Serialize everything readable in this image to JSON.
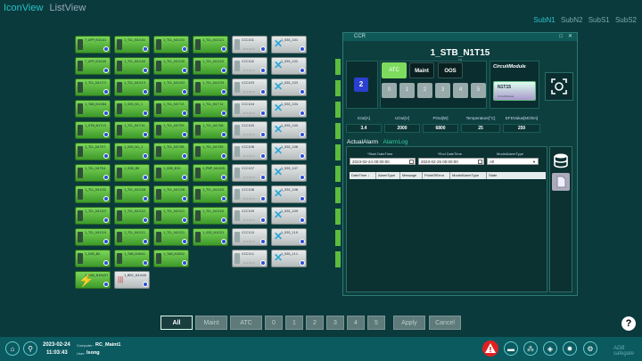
{
  "nav": {
    "iconview": "IconView",
    "listview": "ListView"
  },
  "subnav": [
    "SubN1",
    "SubN2",
    "SubS1",
    "SubS2"
  ],
  "tiles": [
    {
      "label": "7_APP_N1G41",
      "type": "green"
    },
    {
      "label": "1_TCL_N1G41",
      "type": "green"
    },
    {
      "label": "1_TCL_N1G31",
      "type": "green"
    },
    {
      "label": "1_TCL_N1G21",
      "type": "green"
    },
    {
      "label": "CCC101",
      "type": "grey"
    },
    {
      "label": "1_SSS_101",
      "type": "grey-x"
    },
    {
      "label": "7_APP_N1G40",
      "type": "green"
    },
    {
      "label": "1_TCL_N1G40",
      "type": "green"
    },
    {
      "label": "1_TCL_N1G30",
      "type": "green"
    },
    {
      "label": "1_TCL_N1G20",
      "type": "green"
    },
    {
      "label": "CCC102",
      "type": "grey"
    },
    {
      "label": "1_SSS_102",
      "type": "grey-x"
    },
    {
      "label": "1_TCL_N1G73",
      "type": "green"
    },
    {
      "label": "1_TCL_N1G13",
      "type": "green"
    },
    {
      "label": "1_TCL_N1G53",
      "type": "green"
    },
    {
      "label": "1_TCL_N1G33",
      "type": "green"
    },
    {
      "label": "CCC103",
      "type": "grey"
    },
    {
      "label": "1_SSS_103",
      "type": "grey-x"
    },
    {
      "label": "1_TAB_N1G64",
      "type": "green"
    },
    {
      "label": "1_SSS_N1_1",
      "type": "green"
    },
    {
      "label": "1_TCL_N1T13",
      "type": "green"
    },
    {
      "label": "1_TCL_N1T12",
      "type": "green"
    },
    {
      "label": "CCC104",
      "type": "grey"
    },
    {
      "label": "1_SSS_104",
      "type": "grey-x"
    },
    {
      "label": "1_STB_N1T15",
      "type": "green"
    },
    {
      "label": "1_TCL_N1T10",
      "type": "green"
    },
    {
      "label": "1_TCL_N1T09",
      "type": "green"
    },
    {
      "label": "1_TCL_N1T08",
      "type": "green"
    },
    {
      "label": "CCC105",
      "type": "grey"
    },
    {
      "label": "1_SSS_105",
      "type": "grey-x"
    },
    {
      "label": "1_TCL_N1T07",
      "type": "green"
    },
    {
      "label": "1_SSS_N1_1",
      "type": "green"
    },
    {
      "label": "1_TCL_N1T06",
      "type": "green"
    },
    {
      "label": "1_TCL_N1T05",
      "type": "green"
    },
    {
      "label": "CCC106",
      "type": "grey"
    },
    {
      "label": "1_SSS_106",
      "type": "grey-x"
    },
    {
      "label": "1_TCL_N1T04",
      "type": "green"
    },
    {
      "label": "1_SSB_B9",
      "type": "green"
    },
    {
      "label": "1_SSB_B10",
      "type": "green"
    },
    {
      "label": "1_PMP_N1G05",
      "type": "green"
    },
    {
      "label": "CCC107",
      "type": "grey"
    },
    {
      "label": "1_SSS_107",
      "type": "grey-x"
    },
    {
      "label": "1_TCL_N1G32",
      "type": "green"
    },
    {
      "label": "1_TCL_N1G26",
      "type": "green"
    },
    {
      "label": "1_TCL_N1G26",
      "type": "green"
    },
    {
      "label": "1_TCL_N1G25",
      "type": "green"
    },
    {
      "label": "CCC108",
      "type": "grey"
    },
    {
      "label": "1_SSS_108",
      "type": "grey-x"
    },
    {
      "label": "1_TCL_N1G23",
      "type": "green"
    },
    {
      "label": "1_TCL_N1G22",
      "type": "green"
    },
    {
      "label": "1_TCL_N1G21",
      "type": "green"
    },
    {
      "label": "1_TCL_N1G20",
      "type": "green"
    },
    {
      "label": "CCC109",
      "type": "grey"
    },
    {
      "label": "1_SSS_109",
      "type": "grey-x"
    },
    {
      "label": "1_TCL_N1G19",
      "type": "green"
    },
    {
      "label": "1_TCL_N1G21",
      "type": "green"
    },
    {
      "label": "1_TCL_N1G21",
      "type": "green"
    },
    {
      "label": "1_SSS_N1G21",
      "type": "green"
    },
    {
      "label": "CCC110",
      "type": "grey"
    },
    {
      "label": "1_SSS_110",
      "type": "grey-x"
    },
    {
      "label": "1_SSB_B2",
      "type": "green"
    },
    {
      "label": "1_TAB_N1B01",
      "type": "green"
    },
    {
      "label": "1_TAB_N1B02",
      "type": "green"
    },
    {
      "label": "",
      "type": "empty"
    },
    {
      "label": "CCC111",
      "type": "grey"
    },
    {
      "label": "1_SSS_111",
      "type": "grey-x"
    },
    {
      "label": "1_SSB_N1B43T",
      "type": "bolt"
    },
    {
      "label": "1_BRC_N1G46",
      "type": "grey-b"
    }
  ],
  "ccr": {
    "window_title": "CCR",
    "device_name": "1_STB_N1T15",
    "device_sub": "TN",
    "blue_index": "2",
    "modes": [
      "ATC",
      "Maint",
      "OOS"
    ],
    "nums": [
      "0",
      "1",
      "2",
      "3",
      "4",
      "5"
    ],
    "circuit_module_label": "CircuitModule",
    "circuit_module_name": "N1T15",
    "circuit_module_sub": "CircuitModule",
    "metrics": [
      {
        "name": "IOut[A]",
        "value": "3.4"
      },
      {
        "name": "UOut[V]",
        "value": "2000"
      },
      {
        "name": "POut[W]",
        "value": "6800"
      },
      {
        "name": "Temperature[°C]",
        "value": "25"
      },
      {
        "name": "EFDValue[MOhm]",
        "value": "250"
      }
    ],
    "tabs": [
      "ActualAlarm",
      "AlarmLog"
    ],
    "start_label": "*Start DateTime",
    "start_value": "2023-02-24 00:00:00",
    "end_label": "*End DateTime",
    "end_value": "2023-02-25 00:00:00",
    "model_label": "ModelAlarmType",
    "model_value": "All",
    "columns": [
      "DateTime ↓",
      "AlarmType",
      "Message",
      "PointOfError",
      "ModelAlarmType",
      "State"
    ]
  },
  "bottom_buttons": [
    "All",
    "Maint",
    "ATC",
    "0",
    "1",
    "2",
    "3",
    "4",
    "5",
    "Apply",
    "Cancel"
  ],
  "status": {
    "date": "2023-02-24",
    "time": "11:03:43",
    "computer_label": "Computer:",
    "computer": "RC_Maint1",
    "user_label": "User:",
    "user": "lsong",
    "logo": "ADB safegate"
  },
  "colors": {
    "accent": "#27c1c8",
    "background": "#0b3a3c",
    "tile_green": "#5bbd3c",
    "alarm_red": "#e02020"
  }
}
